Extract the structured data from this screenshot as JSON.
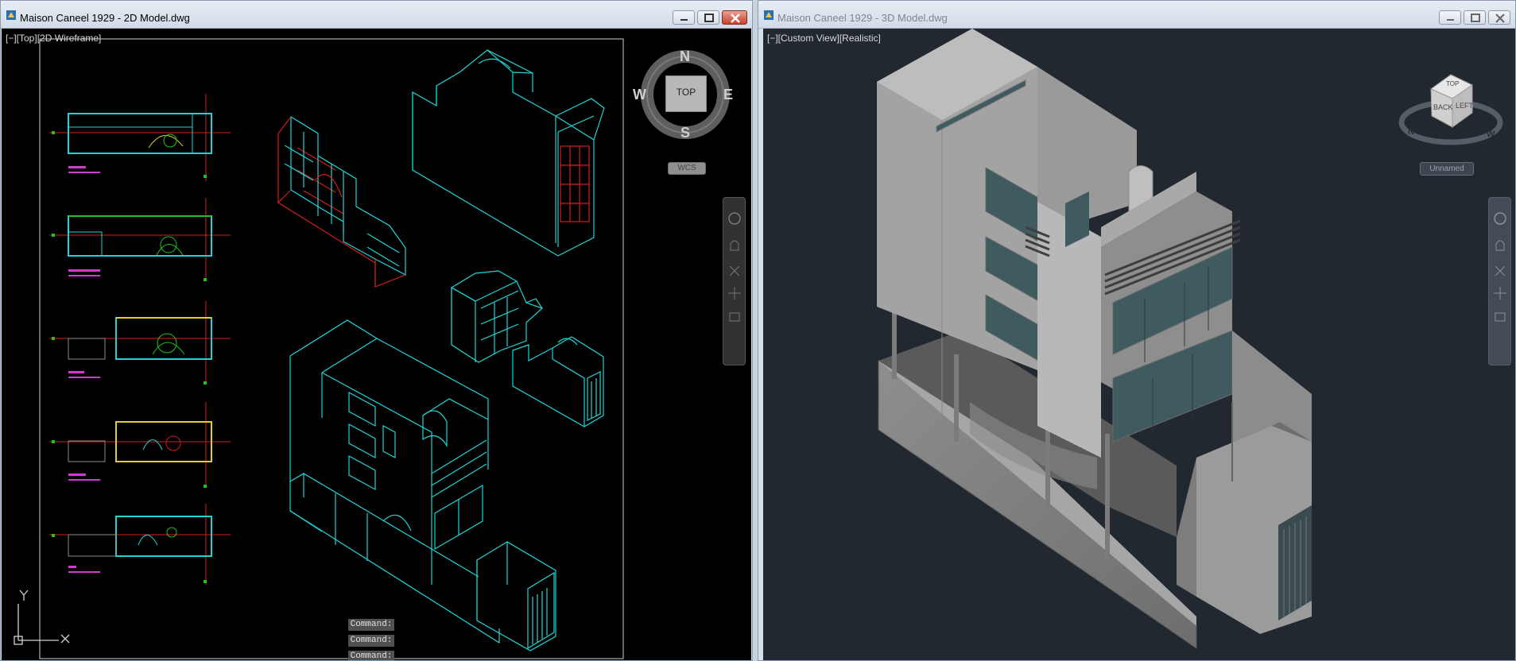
{
  "left_window": {
    "title": "Maison Caneel 1929 - 2D Model.dwg",
    "viewport_label": "[−][Top][2D Wireframe]",
    "compass": {
      "north": "N",
      "south": "S",
      "east": "E",
      "west": "W",
      "top_button": "TOP"
    },
    "ucs_button": "WCS",
    "command_lines": [
      "Command:",
      "Command:",
      "Command:"
    ],
    "axis_labels": {
      "y": "Y",
      "x": "X"
    }
  },
  "right_window": {
    "title": "Maison Caneel 1929 - 3D Model.dwg",
    "viewport_label": "[−][Custom View][Realistic]",
    "viewcube": {
      "top": "TOP",
      "back": "BACK",
      "left": "LEFT",
      "n": "N",
      "w": "W",
      "s": "S"
    },
    "ucs_button": "Unnamed"
  },
  "colors": {
    "cad_background": "#000000",
    "cyan": "#1fd6d6",
    "red": "#d21f1f",
    "green": "#22c022",
    "magenta": "#d13ad1",
    "yellow": "#e0d21f",
    "render_background": "#212830",
    "concrete": "#9a9a9a",
    "glass": "#3f5b60"
  },
  "icons": [
    "app-icon",
    "minimize-icon",
    "maximize-icon",
    "close-icon",
    "compass-icon",
    "viewcube-icon",
    "navbar-icon",
    "ucs-icon"
  ]
}
